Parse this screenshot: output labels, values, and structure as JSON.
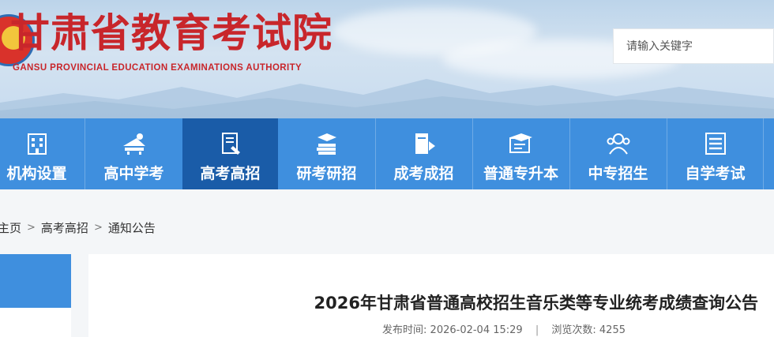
{
  "header": {
    "logo_cn": "甘肃省教育考试院",
    "logo_en": "GANSU PROVINCIAL EDUCATION EXAMINATIONS AUTHORITY",
    "search_placeholder": "请输入关键字"
  },
  "nav": {
    "items": [
      {
        "label": "机构设置",
        "icon": "building-icon"
      },
      {
        "label": "高中学考",
        "icon": "study-desk-icon"
      },
      {
        "label": "高考高招",
        "icon": "exam-paper-icon",
        "active": true
      },
      {
        "label": "研考研招",
        "icon": "books-graduation-icon"
      },
      {
        "label": "成考成招",
        "icon": "book-flag-icon"
      },
      {
        "label": "普通专升本",
        "icon": "graduation-board-icon"
      },
      {
        "label": "中专招生",
        "icon": "people-icon"
      },
      {
        "label": "自学考试",
        "icon": "list-document-icon"
      }
    ]
  },
  "breadcrumb": {
    "items": [
      "主页",
      "高考高招",
      "通知公告"
    ],
    "separator": ">"
  },
  "article": {
    "title": "2026年甘肃省普通高校招生音乐类等专业统考成绩查询公告",
    "publish_label": "发布时间:",
    "publish_time": "2026-02-04 15:29",
    "divider": "|",
    "views_label": "浏览次数:",
    "views": "4255"
  },
  "colors": {
    "brand_red": "#c8262b",
    "nav_blue": "#3f8fde",
    "nav_active": "#1a5ca8"
  }
}
